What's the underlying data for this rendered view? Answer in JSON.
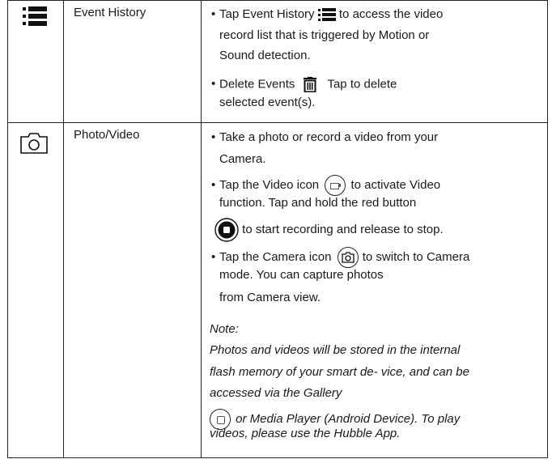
{
  "rows": [
    {
      "icon": "list-icon",
      "feature": "Event History",
      "lines": [
        "Tap Event History",
        "to access the video",
        "record list that is triggered by Motion or",
        "Sound detection.",
        "Delete Events",
        "Tap to delete",
        "selected event(s)."
      ]
    },
    {
      "icon": "camera-icon",
      "feature": "Photo/Video",
      "lines": [
        "Take a photo or record a video from your",
        "Camera.",
        "Tap the Video icon",
        "to activate Video",
        "function. Tap and hold the red button",
        "to start recording and release to stop.",
        "Tap the Camera icon",
        "to switch to Camera",
        "mode. You can capture photos",
        "from Camera view."
      ],
      "note": [
        "Note:",
        "Photos and videos will be stored in the internal",
        "flash memory of your smart de- vice, and can be",
        "accessed via the Gallery",
        "or Media Player (Android Device). To play",
        "videos, please use the Hubble App."
      ]
    }
  ],
  "bullet": "•"
}
